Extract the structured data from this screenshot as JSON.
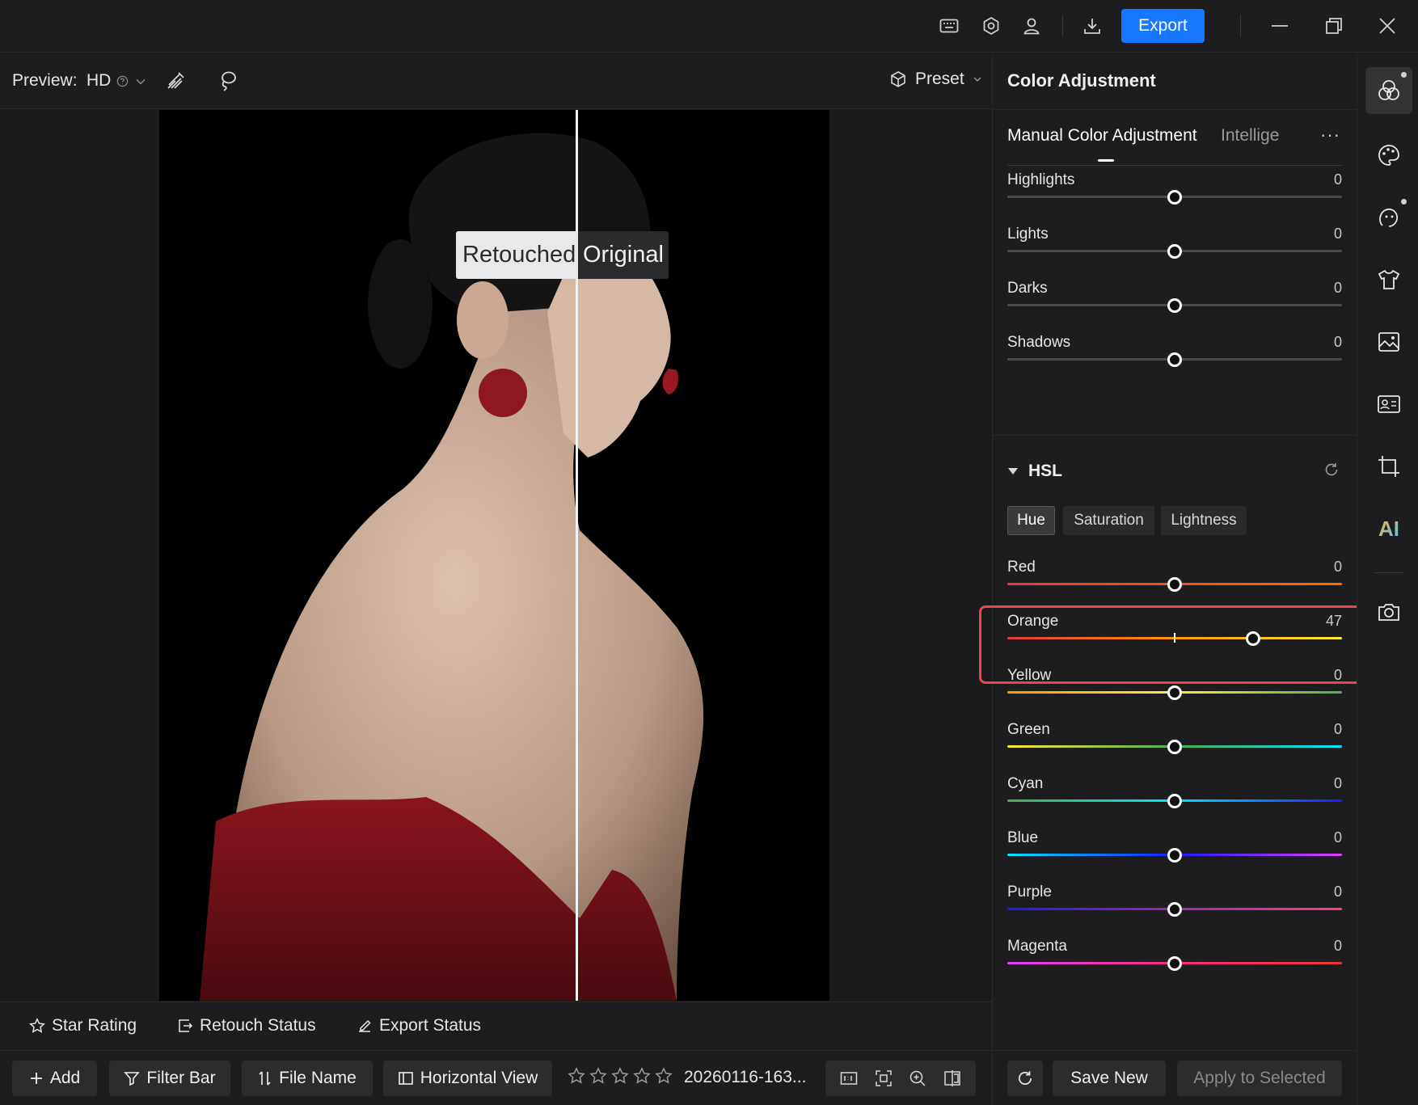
{
  "titlebar": {
    "export_label": "Export",
    "icons": [
      "keyboard-icon",
      "settings-icon",
      "user-icon",
      "download-icon",
      "minimize-icon",
      "restore-icon",
      "close-icon"
    ]
  },
  "preview": {
    "label": "Preview:",
    "quality": "HD",
    "preset_label": "Preset"
  },
  "canvas": {
    "compare_left": "Retouched",
    "compare_right": "Original"
  },
  "status": {
    "star_rating": "Star Rating",
    "retouch_status": "Retouch Status",
    "export_status": "Export Status"
  },
  "bottom": {
    "add": "Add",
    "filter_bar": "Filter Bar",
    "file_name": "File Name",
    "horizontal_view": "Horizontal View",
    "filename_value": "20260116-163...",
    "rating": 0
  },
  "panel": {
    "title": "Color Adjustment",
    "tabs": [
      "Manual Color Adjustment",
      "Intellige"
    ],
    "tone_sliders": [
      {
        "name": "Highlights",
        "value": 0
      },
      {
        "name": "Lights",
        "value": 0
      },
      {
        "name": "Darks",
        "value": 0
      },
      {
        "name": "Shadows",
        "value": 0
      }
    ],
    "hsl": {
      "title": "HSL",
      "modes": [
        "Hue",
        "Saturation",
        "Lightness"
      ],
      "active_mode": "Hue",
      "sliders": [
        {
          "name": "Red",
          "value": 0,
          "gradient": [
            "#e53935",
            "#ff6d00"
          ]
        },
        {
          "name": "Orange",
          "value": 47,
          "gradient": [
            "#e53935",
            "#ff9800",
            "#ffeb3b"
          ]
        },
        {
          "name": "Yellow",
          "value": 0,
          "gradient": [
            "#ff9800",
            "#ffeb3b",
            "#4caf50"
          ]
        },
        {
          "name": "Green",
          "value": 0,
          "gradient": [
            "#ffeb3b",
            "#4caf50",
            "#00e5ff"
          ]
        },
        {
          "name": "Cyan",
          "value": 0,
          "gradient": [
            "#4caf50",
            "#00e5ff",
            "#1a1aff"
          ]
        },
        {
          "name": "Blue",
          "value": 0,
          "gradient": [
            "#00e5ff",
            "#1a1aff",
            "#e040fb"
          ]
        },
        {
          "name": "Purple",
          "value": 0,
          "gradient": [
            "#1a1aff",
            "#9c27b0",
            "#ff4081"
          ]
        },
        {
          "name": "Magenta",
          "value": 0,
          "gradient": [
            "#e040fb",
            "#ff2d78",
            "#e53935"
          ]
        }
      ]
    },
    "footer": {
      "save_new": "Save New",
      "apply_selected": "Apply to Selected"
    }
  },
  "colors": {
    "accent": "#1677ff",
    "highlight": "#e5484d"
  }
}
